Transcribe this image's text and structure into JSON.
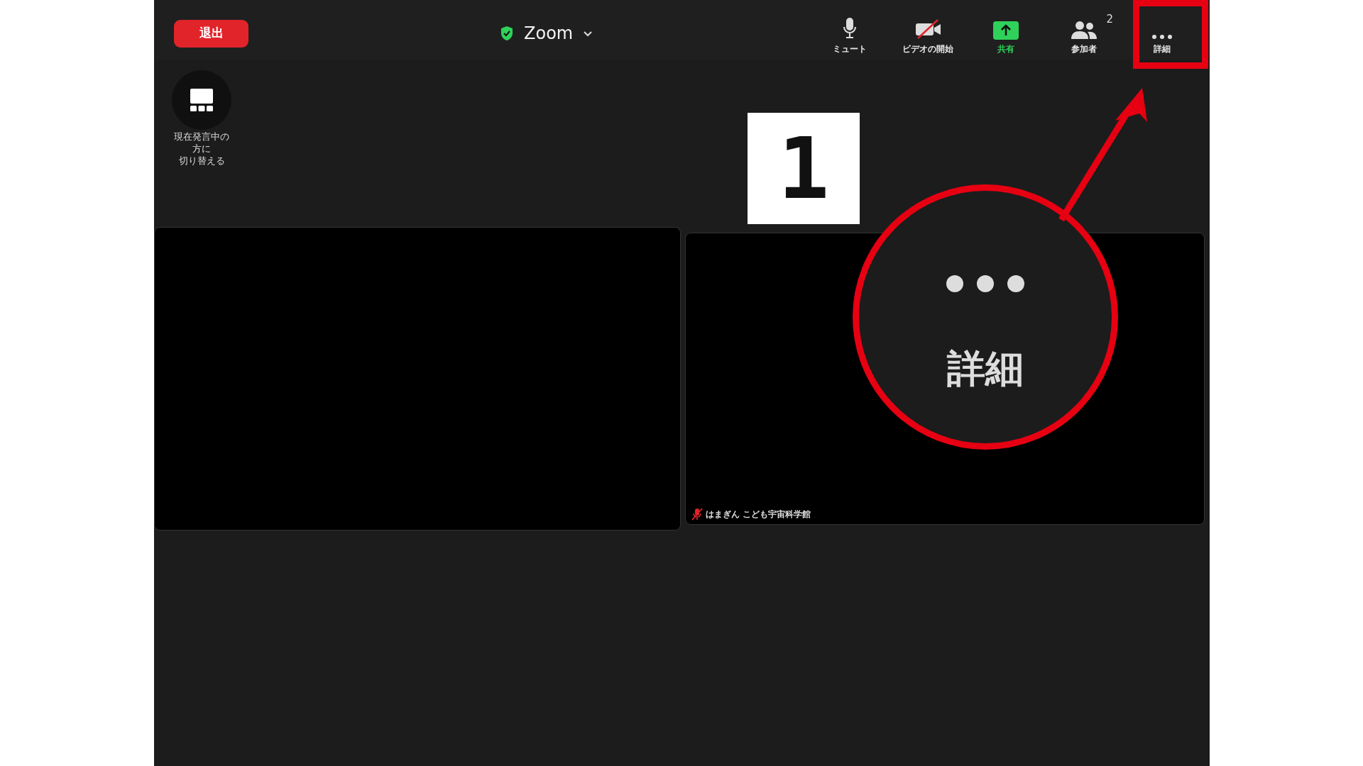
{
  "toolbar": {
    "leave_button": "退出",
    "title": "Zoom",
    "items": [
      {
        "kind": "mic",
        "label": "ミュート"
      },
      {
        "kind": "video_off",
        "label": "ビデオの開始"
      },
      {
        "kind": "share",
        "label": "共有"
      },
      {
        "kind": "participants",
        "label": "参加者",
        "badge": "2"
      },
      {
        "kind": "more",
        "label": "詳細"
      }
    ]
  },
  "switch_view": {
    "label_lines": [
      "現在発言中の",
      "方に",
      "切り替える"
    ]
  },
  "video_tiles": [
    {
      "kind": "blank"
    },
    {
      "kind": "named",
      "name": "はまぎん こども宇宙科学館",
      "muted": true
    }
  ],
  "annotations": {
    "step_number": "1",
    "callout_label": "詳細"
  }
}
